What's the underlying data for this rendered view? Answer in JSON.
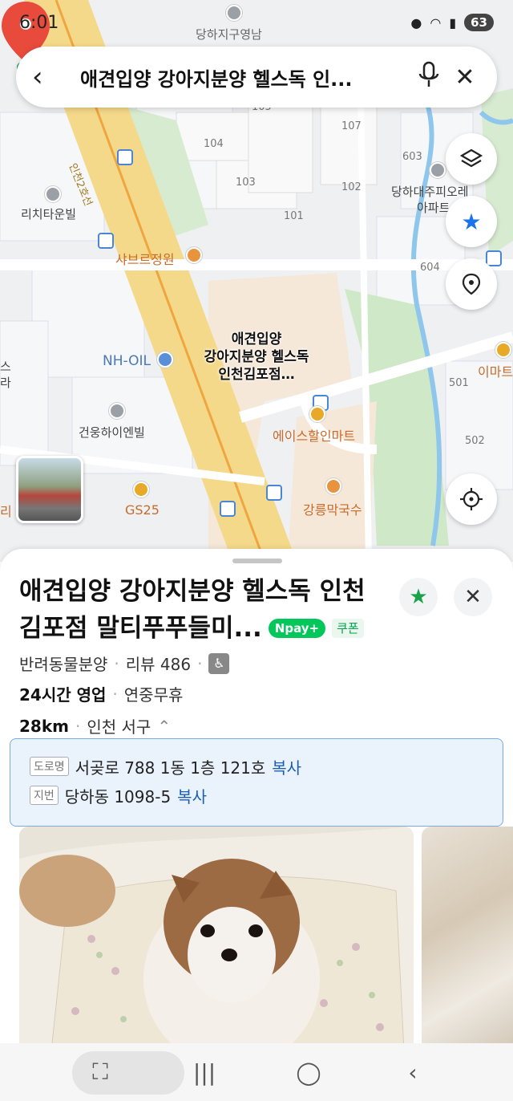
{
  "status_bar": {
    "time": "6:01",
    "battery": "63"
  },
  "search": {
    "query": "애견입양 강아지분양 헬스독 인..."
  },
  "map": {
    "labels": {
      "top_center": "당하지구영남",
      "lichi": "리치타운빌",
      "shabre": "샤브르정원",
      "nh": "NH-OIL",
      "geonung": "건웅하이엔빌",
      "ace": "에이스할인마트",
      "gs25": "GS25",
      "gangneung": "강릉막국수",
      "dangha": "당하대주피오레",
      "apart": "아파트",
      "emart": "이마트",
      "road": "인천2호선",
      "n104": "104",
      "n103": "103",
      "n105": "105",
      "n107": "107",
      "n102": "102",
      "n101": "101",
      "n603": "603",
      "n604": "604",
      "n501": "501",
      "n502": "502",
      "left_edge1": "스",
      "left_edge2": "라",
      "left_edge3": "리"
    },
    "pin_label": [
      "애견입양",
      "강아지분양 헬스독",
      "인천김포점…"
    ],
    "accent": "#e84a3c"
  },
  "place": {
    "title_line1": "애견입양 강아지분양 헬스독 인천",
    "title_line2": "김포점 말티푸푸들미...",
    "npay": "Npay+",
    "coupon": "쿠폰",
    "category": "반려동물분양",
    "review": "리뷰 486",
    "hours": "24시간 영업",
    "holiday": "연중무휴",
    "distance": "28km",
    "region": "인천 서구",
    "road_tag": "도로명",
    "road_addr": "서곶로 788 1동 1층 121호",
    "lot_tag": "지번",
    "lot_addr": "당하동 1098-5",
    "copy": "복사"
  }
}
